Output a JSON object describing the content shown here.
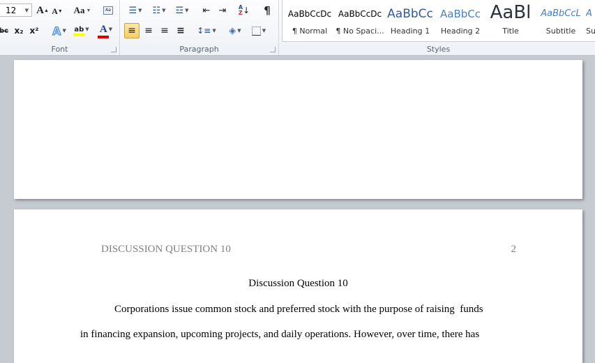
{
  "ribbon": {
    "font_group": {
      "label": "Font",
      "font_size": "12",
      "grow_font": "A",
      "shrink_font": "A",
      "change_case": "Aa",
      "strikethrough": "abc",
      "subscript": "x₂",
      "superscript": "x²",
      "text_effects": "A",
      "highlight": "ab",
      "font_color": "A",
      "highlight_color": "#ffff00",
      "font_color_value": "#e00000"
    },
    "paragraph_group": {
      "label": "Paragraph",
      "show_marks": "¶"
    },
    "styles_group": {
      "label": "Styles",
      "items": [
        {
          "preview": "AaBbCcDc",
          "name": "¶ Normal"
        },
        {
          "preview": "AaBbCcDc",
          "name": "¶ No Spaci..."
        },
        {
          "preview": "AaBbCc",
          "name": "Heading 1"
        },
        {
          "preview": "AaBbCc",
          "name": "Heading 2"
        },
        {
          "preview": "AaBl",
          "name": "Title"
        },
        {
          "preview": "AaBbCcL",
          "name": "Subtitle"
        },
        {
          "preview": "A",
          "name": "Su"
        }
      ]
    }
  },
  "document": {
    "page2": {
      "header_title": "DISCUSSION QUESTION 10",
      "page_number": "2",
      "heading": "Discussion Question 10",
      "lines": [
        "Corporations issue common stock and preferred stock with the purpose of raising  funds",
        "in financing expansion, upcoming projects, and daily operations. However, over time, there has"
      ]
    }
  }
}
